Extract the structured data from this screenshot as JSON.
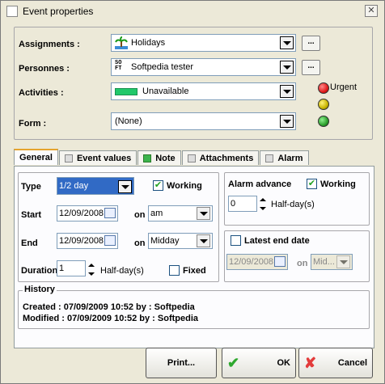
{
  "window": {
    "title": "Event properties",
    "close_glyph": "✕"
  },
  "assignments": {
    "label": "Assignments :",
    "value": "Holidays",
    "more": "..."
  },
  "personnes": {
    "label": "Personnes :",
    "value": "Softpedia tester",
    "more": "..."
  },
  "activities": {
    "label": "Activities :",
    "value": "Unavailable",
    "color": "#21c86a"
  },
  "form": {
    "label": "Form :",
    "value": "(None)"
  },
  "priority": {
    "urgent_label": "Urgent",
    "colors": [
      "#e11c1c",
      "#c8b400",
      "#2ea02e"
    ]
  },
  "tabs": [
    {
      "label": "General"
    },
    {
      "label": "Event values"
    },
    {
      "label": "Note"
    },
    {
      "label": "Attachments"
    },
    {
      "label": "Alarm"
    }
  ],
  "general": {
    "type_label": "Type",
    "type_value": "1/2 day",
    "working_label": "Working",
    "working_checked": true,
    "start_label": "Start",
    "start_date": "12/09/2008",
    "start_on": "on",
    "start_period": "am",
    "end_label": "End",
    "end_date": "12/09/2008",
    "end_on": "on",
    "end_period": "Midday",
    "duration_label": "Duration",
    "duration_value": "1",
    "duration_unit": "Half-day(s)",
    "fixed_label": "Fixed",
    "fixed_checked": false
  },
  "alarm": {
    "advance_label": "Alarm advance",
    "working_label": "Working",
    "working_checked": true,
    "value": "0",
    "unit": "Half-day(s)",
    "latest_label": "Latest end date",
    "latest_checked": false,
    "latest_date": "12/09/2008",
    "latest_on": "on",
    "latest_period": "Mid..."
  },
  "history": {
    "legend": "History",
    "created": "Created :  07/09/2009 10:52 by : Softpedia",
    "modified": "Modified : 07/09/2009 10:52 by : Softpedia"
  },
  "buttons": {
    "print": "Print...",
    "ok": "OK",
    "cancel": "Cancel"
  },
  "colors": {
    "ok_check": "#2ea82e",
    "cancel_x": "#e33b3b"
  }
}
